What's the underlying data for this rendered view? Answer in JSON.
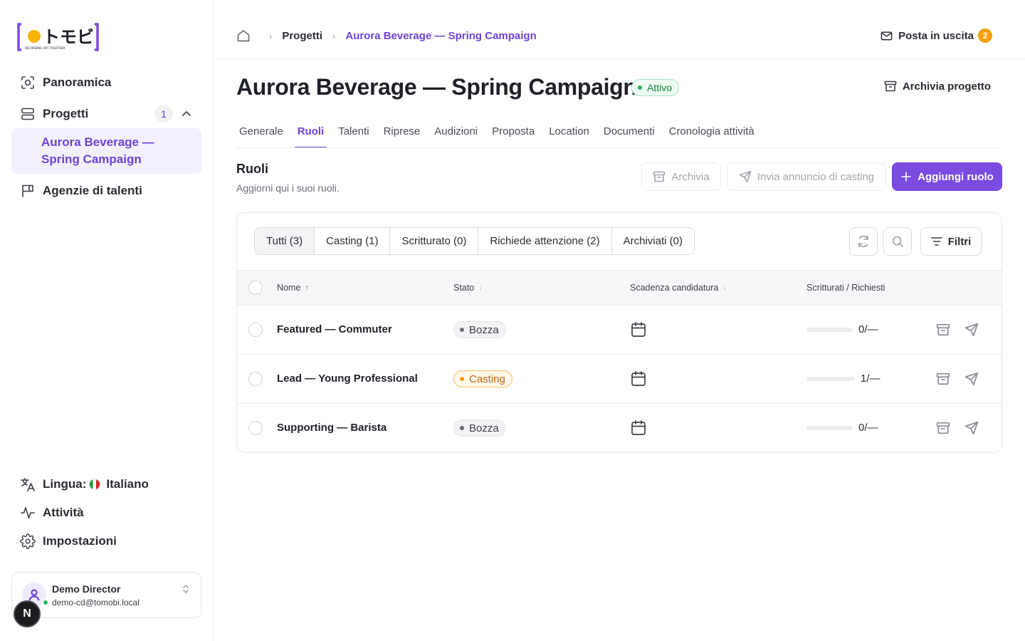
{
  "brand": {
    "logo_text": "トモビ",
    "logo_tagline": "RECORDING ART TOGETHER",
    "accent": "#7b4be0",
    "logo_dot": "#f5b400"
  },
  "sidebar": {
    "nav": [
      {
        "label": "Panoramica",
        "icon": "scan-icon"
      },
      {
        "label": "Progetti",
        "icon": "stack-icon",
        "count": "1"
      },
      {
        "label": "Agenzie di talenti",
        "icon": "flag-icon"
      }
    ],
    "active_project": "Aurora Beverage — Spring Campaign",
    "bottom": {
      "language_label": "Lingua:",
      "language_value": "Italiano",
      "activity": "Attività",
      "settings": "Impostazioni"
    },
    "user": {
      "name": "Demo Director",
      "email": "demo-cd@tomobi.local"
    },
    "n_badge": "N"
  },
  "header": {
    "breadcrumb": [
      "Progetti",
      "Aurora Beverage — Spring Campaign"
    ],
    "outbox_label": "Posta in uscita",
    "outbox_count": "2"
  },
  "project": {
    "title": "Aurora Beverage — Spring Campaign",
    "status": "Attivo",
    "archive_label": "Archivia progetto",
    "tabs": [
      "Generale",
      "Ruoli",
      "Talenti",
      "Riprese",
      "Audizioni",
      "Proposta",
      "Location",
      "Documenti",
      "Cronologia attività"
    ],
    "active_tab": "Ruoli"
  },
  "roles": {
    "title": "Ruoli",
    "subtitle": "Aggiorni qui i suoi ruoli.",
    "archive_btn": "Archivia",
    "send_btn": "Invia annuncio di casting",
    "add_btn": "Aggiungi ruolo",
    "filters": [
      "Tutti (3)",
      "Casting (1)",
      "Scritturato (0)",
      "Richiede attenzione (2)",
      "Archiviati (0)"
    ],
    "filters_btn": "Filtri",
    "columns": {
      "name": "Nome",
      "status": "Stato",
      "deadline": "Scadenza candidatura",
      "booked": "Scritturati / Richiesti"
    },
    "rows": [
      {
        "name": "Featured — Commuter",
        "status": "Bozza",
        "status_kind": "draft",
        "ratio": "0/—",
        "progress": 0
      },
      {
        "name": "Lead — Young Professional",
        "status": "Casting",
        "status_kind": "casting",
        "ratio": "1/—",
        "progress": 0
      },
      {
        "name": "Supporting — Barista",
        "status": "Bozza",
        "status_kind": "draft",
        "ratio": "0/—",
        "progress": 0
      }
    ]
  }
}
